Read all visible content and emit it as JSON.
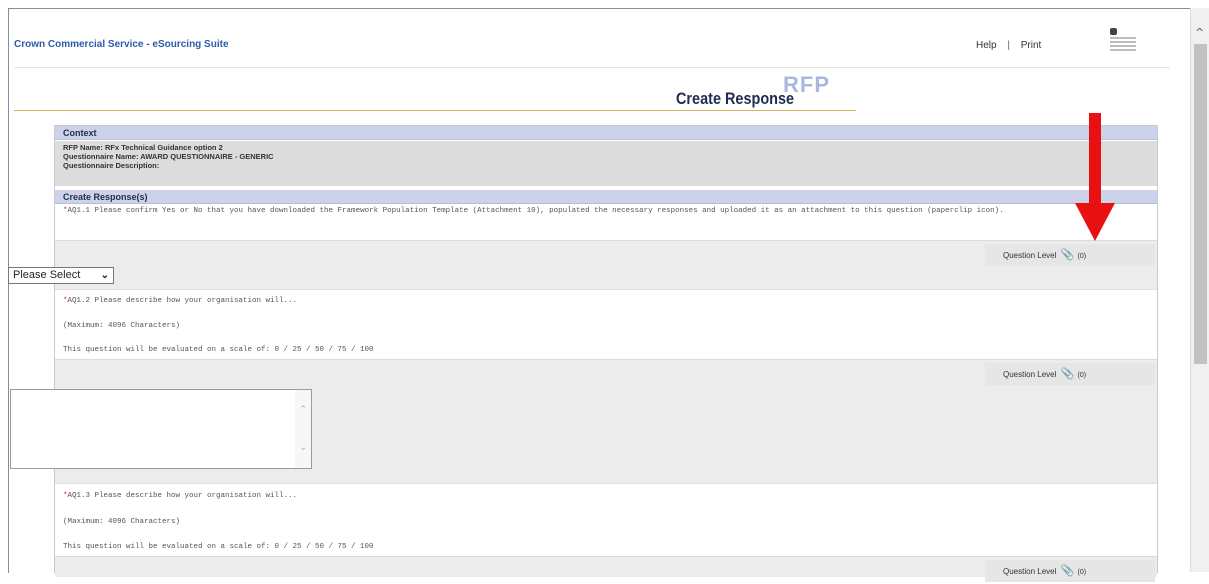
{
  "header": {
    "brand": "Crown Commercial Service - eSourcing Suite",
    "help": "Help",
    "separator": "|",
    "print": "Print"
  },
  "page": {
    "watermark": "RFP",
    "title": "Create Response"
  },
  "context": {
    "heading": "Context",
    "rfp_name": "RFP Name: RFx Technical Guidance option 2",
    "questionnaire_name": "Questionnaire Name: AWARD QUESTIONNAIRE - GENERIC",
    "questionnaire_description": "Questionnaire Description:"
  },
  "responses": {
    "heading": "Create Response(s)",
    "question_level_label": "Question Level",
    "attachment_count": "(0)",
    "q1": {
      "marker": "*",
      "text": "AQ1.1 Please confirm Yes or No that you have downloaded the Framework Population Template (Attachment 10), populated the necessary responses and uploaded it as an attachment to this question (paperclip icon).",
      "select_value": "Please Select"
    },
    "q2": {
      "marker": "*",
      "text": "AQ1.2 Please describe how your organisation will...",
      "maximum": "(Maximum: 4096 Characters)",
      "scale": "This question will be evaluated on a scale of: 0 / 25 / 50 / 75 / 100"
    },
    "q3": {
      "marker": "*",
      "text": "AQ1.3 Please describe how your organisation will...",
      "maximum": "(Maximum: 4096 Characters)",
      "scale": "This question will be evaluated on a scale of: 0 / 25 / 50 / 75 / 100"
    }
  },
  "colors": {
    "section_header_bg": "#ccd3e8",
    "highlight_arrow": "#e81010",
    "brand_link": "#2a5ca8"
  },
  "icons": {
    "attachment": "paperclip-icon",
    "logo": "crown-commercial-service-logo"
  }
}
